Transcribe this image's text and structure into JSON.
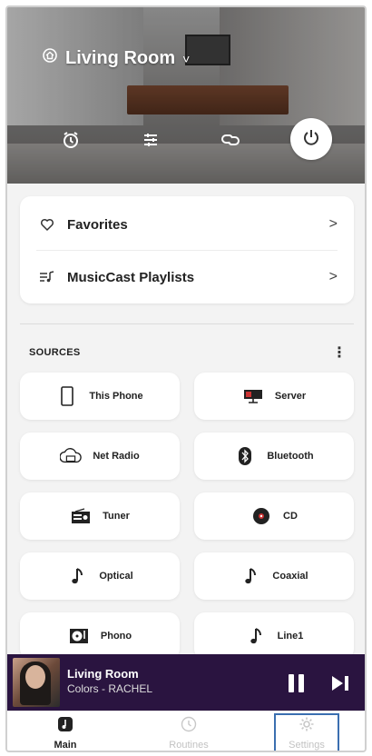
{
  "header": {
    "room_name": "Living Room",
    "room_dropdown_glyph": "˅",
    "controls": [
      {
        "name": "alarm-icon"
      },
      {
        "name": "equalizer-icon"
      },
      {
        "name": "link-icon"
      }
    ],
    "power_icon": "power-icon"
  },
  "favorites": [
    {
      "label": "Favorites",
      "icon": "heart-icon",
      "arrow": ">"
    },
    {
      "label": "MusicCast Playlists",
      "icon": "playlist-icon",
      "arrow": ">"
    }
  ],
  "sources": {
    "title": "SOURCES",
    "menu_glyph": "⋮",
    "items": [
      {
        "label": "This Phone",
        "icon": "phone-icon"
      },
      {
        "label": "Server",
        "icon": "server-icon"
      },
      {
        "label": "Net Radio",
        "icon": "net-radio-icon"
      },
      {
        "label": "Bluetooth",
        "icon": "bluetooth-icon"
      },
      {
        "label": "Tuner",
        "icon": "radio-tuner-icon"
      },
      {
        "label": "CD",
        "icon": "disc-icon"
      },
      {
        "label": "Optical",
        "icon": "music-note-icon"
      },
      {
        "label": "Coaxial",
        "icon": "music-note-icon"
      },
      {
        "label": "Phono",
        "icon": "turntable-icon"
      },
      {
        "label": "Line1",
        "icon": "music-note-icon"
      }
    ]
  },
  "now_playing": {
    "room": "Living Room",
    "track": "Colors - RACHEL"
  },
  "tabs": [
    {
      "label": "Main",
      "icon": "main-icon",
      "active": true
    },
    {
      "label": "Routines",
      "icon": "routines-icon",
      "active": false
    },
    {
      "label": "Settings",
      "icon": "gear-icon",
      "active": false
    }
  ],
  "colors": {
    "accent_dark_purple": "#2a1440",
    "highlight_box": "#3b6fb0",
    "card_bg": "#ffffff",
    "page_bg": "#f3f3f3"
  }
}
